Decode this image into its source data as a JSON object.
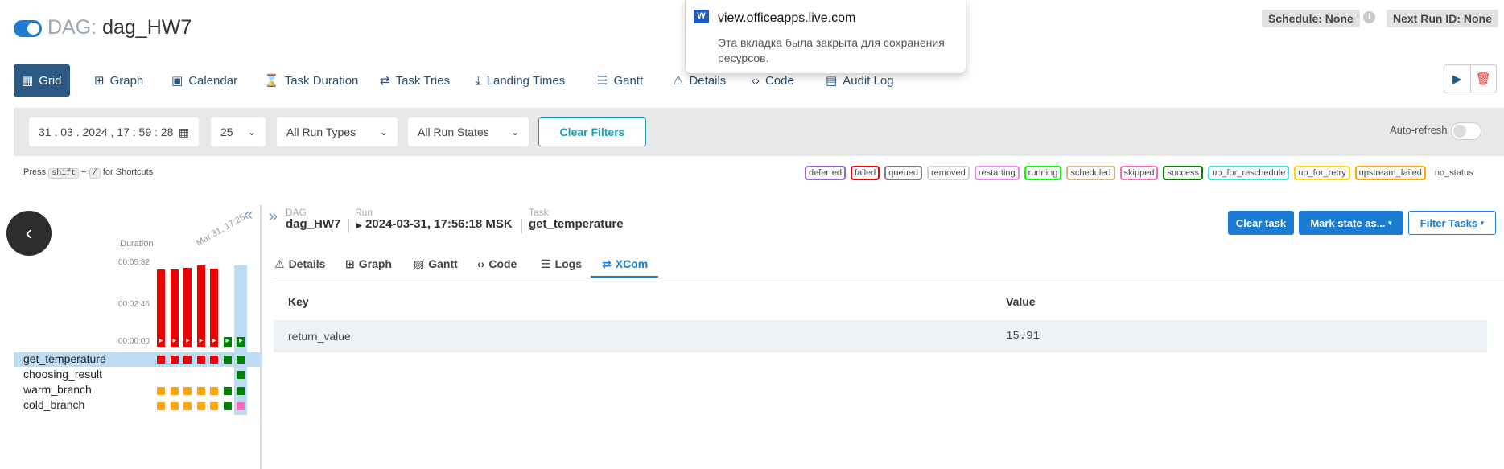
{
  "header": {
    "dag_label": "DAG:",
    "dag_name": "dag_HW7",
    "schedule": "Schedule: None",
    "next_run": "Next Run ID: None",
    "info_icon": "i"
  },
  "toast": {
    "site": "view.officeapps.live.com",
    "message": "Эта вкладка была закрыта для сохранения ресурсов.",
    "icon_letter": "W"
  },
  "nav": {
    "tabs": [
      {
        "label": "Grid",
        "icon": "grid-icon",
        "glyph": "▦"
      },
      {
        "label": "Graph",
        "icon": "graph-icon",
        "glyph": "⊞"
      },
      {
        "label": "Calendar",
        "icon": "calendar-icon",
        "glyph": "▣"
      },
      {
        "label": "Task Duration",
        "icon": "hourglass-icon",
        "glyph": "⌛"
      },
      {
        "label": "Task Tries",
        "icon": "retry-icon",
        "glyph": "⇄"
      },
      {
        "label": "Landing Times",
        "icon": "landing-icon",
        "glyph": "⤓"
      },
      {
        "label": "Gantt",
        "icon": "gantt-icon",
        "glyph": "☰"
      },
      {
        "label": "Details",
        "icon": "warning-icon",
        "glyph": "⚠"
      },
      {
        "label": "Code",
        "icon": "code-icon",
        "glyph": "‹›"
      },
      {
        "label": "Audit Log",
        "icon": "audit-icon",
        "glyph": "▤"
      }
    ]
  },
  "filters": {
    "date": "31 . 03 . 2024 ,  17 : 59 : 28",
    "limit": "25",
    "run_types": "All Run Types",
    "run_states": "All Run States",
    "clear_label": "Clear Filters",
    "autorefresh_label": "Auto-refresh"
  },
  "shortcuts": {
    "prefix": "Press",
    "key1": "shift",
    "plus": "+",
    "key2": "/",
    "suffix": "for Shortcuts"
  },
  "legend": [
    {
      "label": "deferred",
      "color": "#9966cc"
    },
    {
      "label": "failed",
      "color": "#ee0000"
    },
    {
      "label": "queued",
      "color": "#808080"
    },
    {
      "label": "removed",
      "color": "#d3d3d3"
    },
    {
      "label": "restarting",
      "color": "#ee82ee"
    },
    {
      "label": "running",
      "color": "#00ff00"
    },
    {
      "label": "scheduled",
      "color": "#d2b48c"
    },
    {
      "label": "skipped",
      "color": "#ff69b4"
    },
    {
      "label": "success",
      "color": "#008000"
    },
    {
      "label": "up_for_reschedule",
      "color": "#40e0d0"
    },
    {
      "label": "up_for_retry",
      "color": "#ffd700"
    },
    {
      "label": "upstream_failed",
      "color": "#ffa500"
    },
    {
      "label": "no_status",
      "color": "transparent"
    }
  ],
  "grid": {
    "duration_label": "Duration",
    "date_label": "Mar 31, 17:25",
    "ticks": [
      "00:05:32",
      "00:02:46",
      "00:00:00"
    ],
    "runs": [
      {
        "state": "failed",
        "duration_fraction": 0.95
      },
      {
        "state": "failed",
        "duration_fraction": 0.95
      },
      {
        "state": "failed",
        "duration_fraction": 0.97
      },
      {
        "state": "failed",
        "duration_fraction": 1.0
      },
      {
        "state": "failed",
        "duration_fraction": 0.96
      },
      {
        "state": "success",
        "duration_fraction": 0.12
      },
      {
        "state": "success",
        "duration_fraction": 0.12
      }
    ],
    "tasks": [
      {
        "name": "get_temperature",
        "states": [
          "failed",
          "failed",
          "failed",
          "failed",
          "failed",
          "success",
          "success"
        ]
      },
      {
        "name": "choosing_result",
        "states": [
          "none",
          "none",
          "none",
          "none",
          "none",
          "none",
          "success"
        ]
      },
      {
        "name": "warm_branch",
        "states": [
          "upstream_failed",
          "upstream_failed",
          "upstream_failed",
          "upstream_failed",
          "upstream_failed",
          "success",
          "success"
        ]
      },
      {
        "name": "cold_branch",
        "states": [
          "upstream_failed",
          "upstream_failed",
          "upstream_failed",
          "upstream_failed",
          "upstream_failed",
          "success",
          "skipped"
        ]
      }
    ],
    "state_colors": {
      "failed": "#ee0000",
      "success": "#008000",
      "upstream_failed": "#ffa500",
      "skipped": "#ff69b4",
      "none": "transparent"
    }
  },
  "breadcrumb": {
    "dag_small": "DAG",
    "dag_value": "dag_HW7",
    "run_small": "Run",
    "run_value": "2024-03-31, 17:56:18 MSK",
    "task_small": "Task",
    "task_value": "get_temperature"
  },
  "actions": {
    "clear_task": "Clear task",
    "mark_state": "Mark state as...",
    "filter_tasks": "Filter Tasks"
  },
  "subtabs": [
    {
      "label": "Details",
      "glyph": "⚠",
      "icon": "warning-icon"
    },
    {
      "label": "Graph",
      "glyph": "⊞",
      "icon": "graph-icon"
    },
    {
      "label": "Gantt",
      "glyph": "▨",
      "icon": "gantt-icon"
    },
    {
      "label": "Code",
      "glyph": "‹›",
      "icon": "code-icon"
    },
    {
      "label": "Logs",
      "glyph": "☰",
      "icon": "logs-icon"
    },
    {
      "label": "XCom",
      "glyph": "⇄",
      "icon": "xcom-icon"
    }
  ],
  "xcom": {
    "headers": {
      "key": "Key",
      "value": "Value"
    },
    "rows": [
      {
        "key": "return_value",
        "value": "15.91"
      }
    ]
  }
}
